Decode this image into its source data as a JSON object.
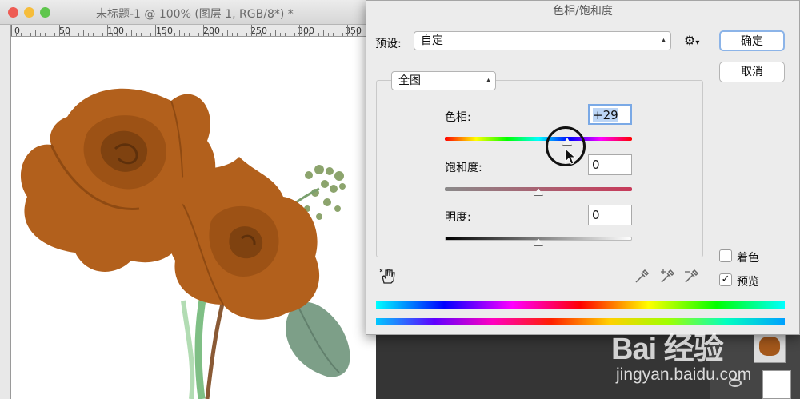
{
  "document": {
    "title": "未标题-1 @ 100% (图层 1, RGB/8*) *",
    "ruler_labels": [
      "0",
      "50",
      "100",
      "150",
      "200",
      "250",
      "300",
      "350"
    ]
  },
  "dialog": {
    "title": "色相/饱和度",
    "preset_label": "预设:",
    "preset_value": "自定",
    "ok_label": "确定",
    "cancel_label": "取消",
    "channel_value": "全图",
    "hue": {
      "label": "色相:",
      "value": "+29"
    },
    "saturation": {
      "label": "饱和度:",
      "value": "0"
    },
    "lightness": {
      "label": "明度:",
      "value": "0"
    },
    "colorize": {
      "label": "着色",
      "checked": false
    },
    "preview": {
      "label": "预览",
      "checked": true
    }
  },
  "watermark": {
    "main": "Bai 经验",
    "sub": "jingyan.baidu.com"
  },
  "colors": {
    "close": "#ee5c54",
    "minimize": "#f6bd3b",
    "maximize": "#5fc64d",
    "rose": "#b2601c",
    "number_selected": "#bcd5f5"
  }
}
